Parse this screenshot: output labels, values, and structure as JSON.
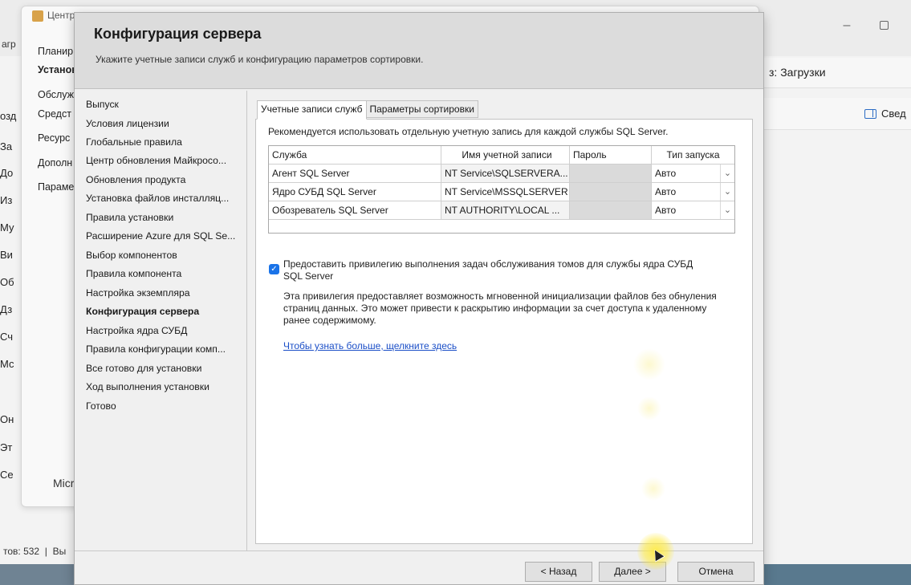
{
  "explorer": {
    "address": "з: Загрузки",
    "details_label": "Свед",
    "status": "тов: 532",
    "status_b": "Вы",
    "left_top": "агр",
    "left_items": [
      "озд",
      "За",
      "До",
      "Из",
      "Му",
      "Ви",
      "Об",
      "Дз",
      "Сч",
      "Мс",
      "Он",
      "Эт",
      "Се"
    ]
  },
  "center": {
    "title": "Центр",
    "nav": [
      "Планир",
      "Установ",
      "Обслуж",
      "Средст",
      "Ресурс",
      "Дополн",
      "Параме"
    ],
    "brand": "Micros"
  },
  "dialog": {
    "title": "Конфигурация сервера",
    "subtitle": "Укажите учетные записи служб и конфигурацию параметров сортировки.",
    "steps": [
      "Выпуск",
      "Условия лицензии",
      "Глобальные правила",
      "Центр обновления Майкросо...",
      "Обновления продукта",
      "Установка файлов инсталляц...",
      "Правила установки",
      "Расширение Azure для SQL Se...",
      "Выбор компонентов",
      "Правила компонента",
      "Настройка экземпляра",
      "Конфигурация сервера",
      "Настройка ядра СУБД",
      "Правила конфигурации комп...",
      "Все готово для установки",
      "Ход выполнения установки",
      "Готово"
    ],
    "tabs": [
      "Учетные записи служб",
      "Параметры сортировки"
    ],
    "recommendation": "Рекомендуется использовать отдельную учетную запись для каждой службы SQL Server.",
    "table": {
      "headers": [
        "Служба",
        "Имя учетной записи",
        "Пароль",
        "Тип запуска"
      ],
      "rows": [
        {
          "service": "Агент SQL Server",
          "account": "NT Service\\SQLSERVERA...",
          "password": "",
          "startup": "Авто"
        },
        {
          "service": "Ядро СУБД SQL Server",
          "account": "NT Service\\MSSQLSERVER",
          "password": "",
          "startup": "Авто"
        },
        {
          "service": "Обозреватель SQL Server",
          "account": "NT AUTHORITY\\LOCAL ...",
          "password": "",
          "startup": "Авто"
        }
      ]
    },
    "checkbox_label": "Предоставить привилегию выполнения задач обслуживания томов для службы ядра СУБД SQL Server",
    "checkbox_checked": true,
    "description": "Эта привилегия предоставляет возможность мгновенной инициализации файлов без обнуления страниц данных. Это может привести к раскрытию информации за счет доступа к удаленному ранее содержимому.",
    "more_link": "Чтобы узнать больше, щелкните здесь",
    "buttons": {
      "back": "< Назад",
      "next": "Далее >",
      "cancel": "Отмена"
    }
  },
  "colors": {
    "accent": "#1a73e8",
    "link": "#1a4ec7",
    "highlight": "#ffeb3c"
  }
}
